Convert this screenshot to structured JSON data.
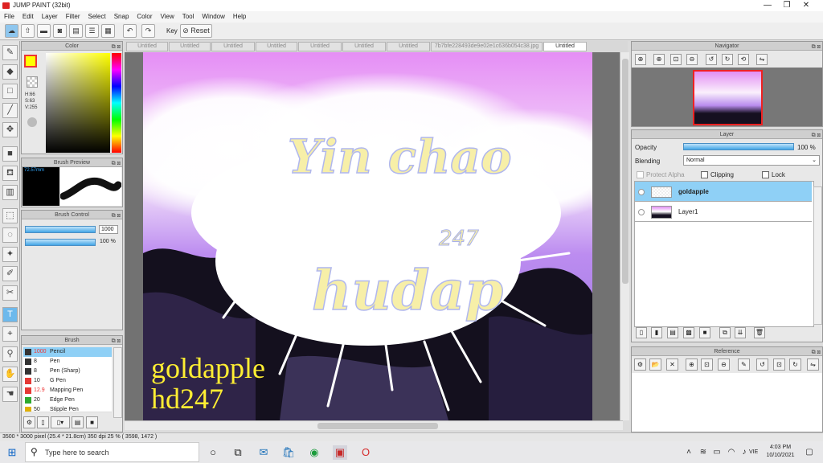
{
  "app": {
    "title": "JUMP PAINT (32bit)",
    "window_controls": {
      "minimize": "—",
      "maximize": "❐",
      "close": "✕"
    }
  },
  "menu": [
    "File",
    "Edit",
    "Layer",
    "Filter",
    "Select",
    "Snap",
    "Color",
    "View",
    "Tool",
    "Window",
    "Help"
  ],
  "toolbar": {
    "key_label": "Key",
    "reset_label": "Reset",
    "undo_icon": "undo-icon",
    "redo_icon": "redo-icon"
  },
  "tabs": [
    {
      "label": "Untitled"
    },
    {
      "label": "Untitled"
    },
    {
      "label": "Untitled"
    },
    {
      "label": "Untitled"
    },
    {
      "label": "Untitled"
    },
    {
      "label": "Untitled"
    },
    {
      "label": "Untitled"
    },
    {
      "label": "7b7bfe228493de9e02e1c636b054c38.jpg"
    },
    {
      "label": "Untitled",
      "active": true
    }
  ],
  "color_panel": {
    "title": "Color",
    "h": "H:66",
    "s": "S:63",
    "v": "V:255",
    "main_color": "#ffff00"
  },
  "brush_preview": {
    "title": "Brush Preview",
    "size": "72.57mm"
  },
  "brush_control": {
    "title": "Brush Control",
    "size_value": "1000",
    "opacity_value": "100 %"
  },
  "brush_panel": {
    "title": "Brush",
    "items": [
      {
        "size": "1000",
        "name": "Pencil",
        "color": "#333333",
        "selected": true
      },
      {
        "size": "8",
        "name": "Pen",
        "color": "#333333"
      },
      {
        "size": "8",
        "name": "Pen (Sharp)",
        "color": "#333333"
      },
      {
        "size": "10",
        "name": "G Pen",
        "color": "#e53935"
      },
      {
        "size": "12.9",
        "name": "Mapping Pen",
        "color": "#e53935"
      },
      {
        "size": "20",
        "name": "Edge Pen",
        "color": "#2eaa2e"
      },
      {
        "size": "50",
        "name": "Stipple Pen",
        "color": "#e0b000"
      }
    ]
  },
  "canvas": {
    "lettering_top": "Yin chao",
    "lettering_bottom": "hudap",
    "lettering_number": "247",
    "watermark_line1": "goldapple",
    "watermark_line2": "hd247"
  },
  "navigator": {
    "title": "Navigator"
  },
  "layer_panel": {
    "title": "Layer",
    "opacity_label": "Opacity",
    "opacity_value": "100 %",
    "blending_label": "Blending",
    "blending_value": "Normal",
    "protect_alpha": "Protect Alpha",
    "clipping": "Clipping",
    "lock": "Lock",
    "layers": [
      {
        "name": "goldapple",
        "selected": true
      },
      {
        "name": "Layer1",
        "selected": false
      }
    ]
  },
  "reference": {
    "title": "Reference"
  },
  "status": {
    "text": "3500 * 3000 pixel  (25.4 * 21.8cm)  350 dpi  25 %  ( 3598, 1472 )"
  },
  "taskbar": {
    "search_placeholder": "Type here to search",
    "language": "VIE",
    "time": "4:03 PM",
    "date": "10/10/2021"
  },
  "colors": {
    "accent": "#43a6e6",
    "selection": "#8fd0f6",
    "watermark": "#ffee33"
  }
}
